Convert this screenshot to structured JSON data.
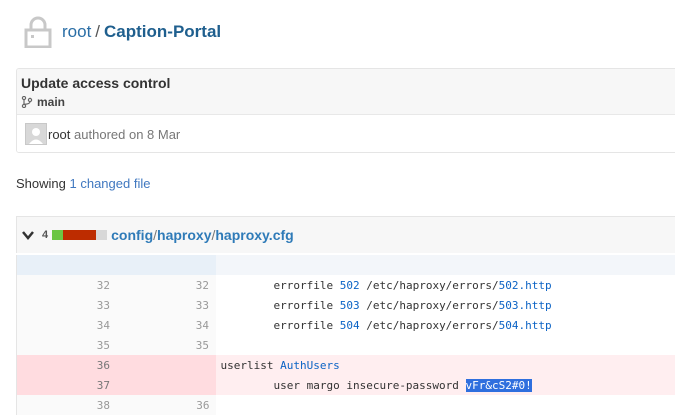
{
  "header": {
    "owner": "root",
    "separator": "/",
    "repo": "Caption-Portal"
  },
  "commit": {
    "title": "Update access control",
    "branch": "main",
    "author": "root",
    "authored_text": "authored on 8 Mar"
  },
  "summary": {
    "prefix": "Showing",
    "link": "1 changed file"
  },
  "file": {
    "change_count": "4",
    "path_dir1": "config",
    "path_dir2": "haproxy",
    "path_file": "haproxy.cfg",
    "diffstat_colors": [
      "#6cc644",
      "#bd2c00",
      "#bd2c00",
      "#bd2c00",
      "#d8d8d8"
    ]
  },
  "diff": {
    "lines": [
      {
        "old": "32",
        "new": "32",
        "indent": "        ",
        "cmd": "errorfile ",
        "code": "502",
        "path": " /etc/haproxy/errors/",
        "file": "502.http"
      },
      {
        "old": "33",
        "new": "33",
        "indent": "        ",
        "cmd": "errorfile ",
        "code": "503",
        "path": " /etc/haproxy/errors/",
        "file": "503.http"
      },
      {
        "old": "34",
        "new": "34",
        "indent": "        ",
        "cmd": "errorfile ",
        "code": "504",
        "path": " /etc/haproxy/errors/",
        "file": "504.http"
      },
      {
        "old": "35",
        "new": "35"
      }
    ],
    "deleted": [
      {
        "old": "36",
        "kw": "userlist ",
        "name": "AuthUsers"
      },
      {
        "old": "37",
        "indent": "        ",
        "text": "user margo insecure-password ",
        "secret": "vFr&cS2#0!"
      }
    ],
    "last": {
      "old": "38",
      "new": "36"
    }
  }
}
